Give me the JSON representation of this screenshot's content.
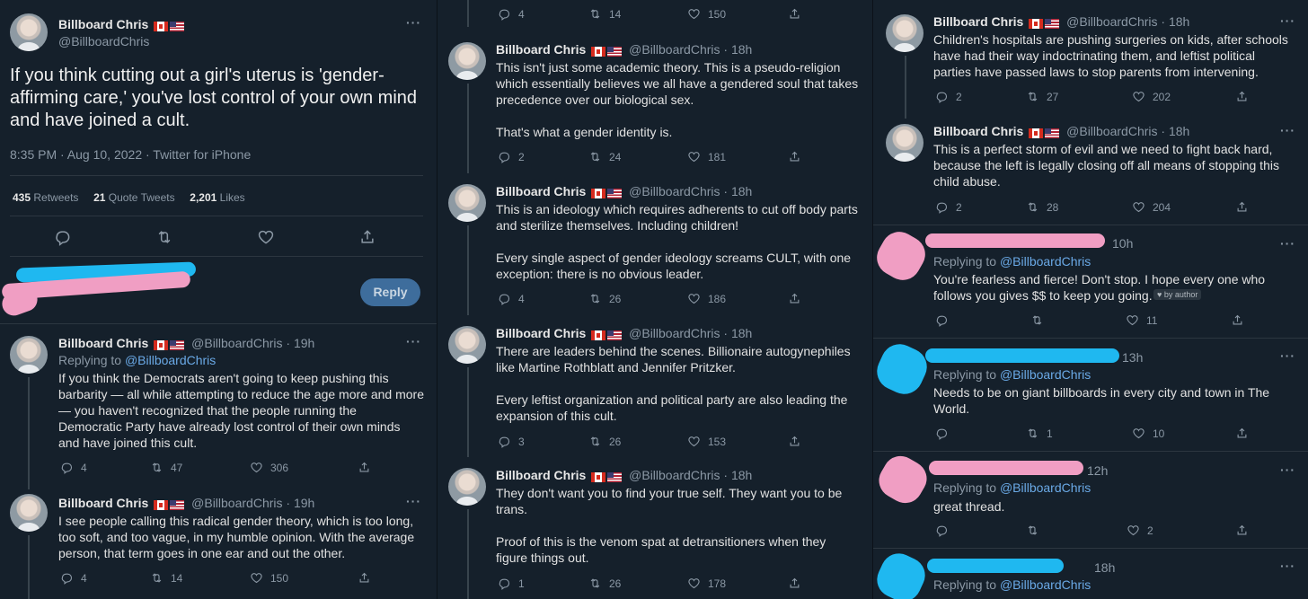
{
  "colors": {
    "background": "#15202b",
    "link": "#6aa9e6",
    "muted": "#8b98a5",
    "reply_button": "#3e6d9c",
    "scribble_pink": "#f09ec3",
    "scribble_blue": "#1fb8f0"
  },
  "author": {
    "name": "Billboard Chris",
    "handle": "@BillboardChris"
  },
  "main_tweet": {
    "text": "If you think cutting out a girl's uterus is 'gender-affirming care,' you've lost control of your own mind and have joined a cult.",
    "meta": "8:35 PM · Aug 10, 2022 · Twitter for iPhone",
    "retweets": "435",
    "retweets_label": "Retweets",
    "quotes": "21",
    "quotes_label": "Quote Tweets",
    "likes": "2,201",
    "likes_label": "Likes",
    "reply_button": "Reply"
  },
  "col1_replies": [
    {
      "time": "· 19h",
      "replying_label": "Replying to",
      "replying_handle": "@BillboardChris",
      "text": "If you think the Democrats aren't going to keep pushing this\nbarbarity — all while attempting to reduce the age more and more\n— you haven't recognized that the people running the\nDemocratic Party have already lost control of their own minds\nand have joined this cult.",
      "replies": "4",
      "retweets": "47",
      "likes": "306"
    },
    {
      "time": "· 19h",
      "text": "I see people calling this radical gender theory, which is too long,\ntoo soft, and too vague, in my humble opinion. With the average\nperson, that term goes in one ear and out the other.",
      "replies": "4",
      "retweets": "14",
      "likes": "150"
    }
  ],
  "col2_top_actions": {
    "replies": "4",
    "retweets": "14",
    "likes": "150"
  },
  "col2_tweets": [
    {
      "time": "· 18h",
      "text": "This isn't just some academic theory. This is a pseudo-religion\nwhich essentially believes we all have a gendered soul that takes\nprecedence over our biological sex.\n\nThat's what a gender identity is.",
      "replies": "2",
      "retweets": "24",
      "likes": "181"
    },
    {
      "time": "· 18h",
      "text": "This is an ideology which requires adherents to cut off body parts\nand sterilize themselves. Including children!\n\nEvery single aspect of gender ideology screams CULT, with one\nexception: there is no obvious leader.",
      "replies": "4",
      "retweets": "26",
      "likes": "186"
    },
    {
      "time": "· 18h",
      "text": "There are leaders behind the scenes. Billionaire autogynephiles\nlike Martine Rothblatt and Jennifer Pritzker.\n\nEvery leftist organization and political party are also leading the\nexpansion of this cult.",
      "replies": "3",
      "retweets": "26",
      "likes": "153"
    },
    {
      "time": "· 18h",
      "text": "They don't want you to find your true self. They want you to be\ntrans.\n\nProof of this is the venom spat at detransitioners when they\nfigure things out.",
      "replies": "1",
      "retweets": "26",
      "likes": "178"
    }
  ],
  "col3_tweets": [
    {
      "time": "· 18h",
      "text": "Children's hospitals are pushing surgeries on kids, after schools\nhave had their way indoctrinating them, and leftist political\nparties have passed laws to stop parents from intervening.",
      "replies": "2",
      "retweets": "27",
      "likes": "202"
    },
    {
      "time": "· 18h",
      "text": "This is a perfect storm of evil and we need to fight back hard,\nbecause the left is legally closing off all means of stopping this\nchild abuse.",
      "replies": "2",
      "retweets": "28",
      "likes": "204"
    }
  ],
  "col3_replies": [
    {
      "time": "10h",
      "replying_label": "Replying to",
      "replying_handle": "@BillboardChris",
      "text": "You're fearless and fierce!  Don't stop. I hope every one who\nfollows you gives $$ to keep you going.",
      "badge": "by author",
      "replies": "",
      "retweets": "",
      "likes": "11"
    },
    {
      "time": "13h",
      "replying_label": "Replying to",
      "replying_handle": "@BillboardChris",
      "text": "Needs to be on giant billboards in every city and town in The\nWorld.",
      "replies": "",
      "retweets": "1",
      "likes": "10"
    },
    {
      "time": "12h",
      "replying_label": "Replying to",
      "replying_handle": "@BillboardChris",
      "text": "great thread.",
      "replies": "",
      "retweets": "",
      "likes": "2"
    },
    {
      "time": "18h",
      "replying_label": "Replying to",
      "replying_handle": "@BillboardChris"
    }
  ]
}
